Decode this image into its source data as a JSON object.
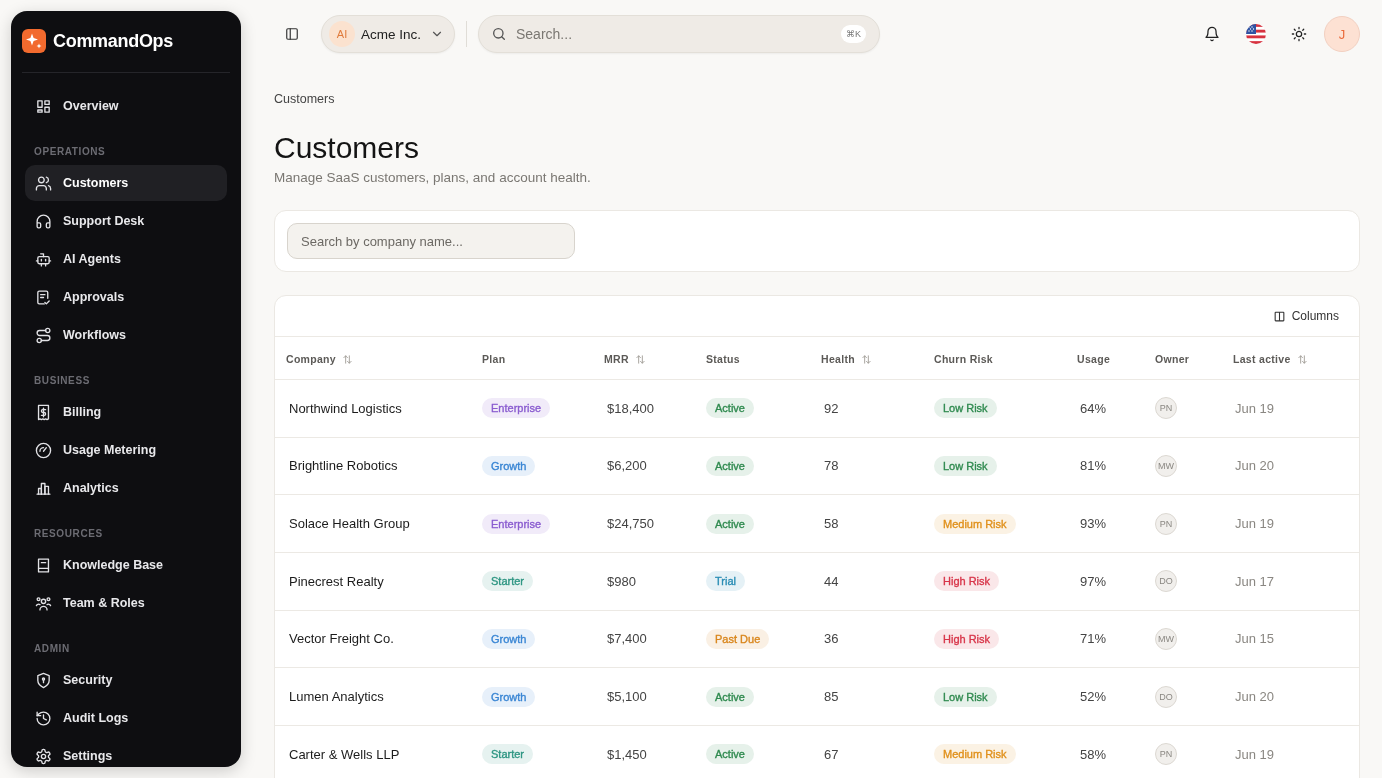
{
  "sidebar": {
    "brand": "CommandOps",
    "sections": [
      {
        "items": [
          {
            "label": "Overview",
            "selected": false
          }
        ]
      },
      {
        "title": "OPERATIONS",
        "items": [
          {
            "label": "Customers",
            "selected": true
          },
          {
            "label": "Support Desk",
            "selected": false
          },
          {
            "label": "AI Agents",
            "selected": false
          },
          {
            "label": "Approvals",
            "selected": false
          },
          {
            "label": "Workflows",
            "selected": false
          }
        ]
      },
      {
        "title": "BUSINESS",
        "items": [
          {
            "label": "Billing",
            "selected": false
          },
          {
            "label": "Usage Metering",
            "selected": false
          },
          {
            "label": "Analytics",
            "selected": false
          }
        ]
      },
      {
        "title": "RESOURCES",
        "items": [
          {
            "label": "Knowledge Base",
            "selected": false
          },
          {
            "label": "Team & Roles",
            "selected": false
          }
        ]
      },
      {
        "title": "ADMIN",
        "items": [
          {
            "label": "Security",
            "selected": false
          },
          {
            "label": "Audit Logs",
            "selected": false
          },
          {
            "label": "Settings",
            "selected": false
          }
        ]
      }
    ]
  },
  "topbar": {
    "org": {
      "initials": "AI",
      "name": "Acme Inc."
    },
    "search": {
      "placeholder": "Search...",
      "shortcut": "⌘K"
    },
    "user": {
      "initials": "J"
    }
  },
  "page_header": {
    "breadcrumb": "Customers",
    "title": "Customers",
    "subtitle": "Manage SaaS customers, plans, and account health."
  },
  "filter": {
    "placeholder": "Search by company name..."
  },
  "table": {
    "columns_button": "Columns",
    "columns": [
      {
        "label": "Company",
        "sortable": true
      },
      {
        "label": "Plan",
        "sortable": false
      },
      {
        "label": "MRR",
        "sortable": true
      },
      {
        "label": "Status",
        "sortable": false
      },
      {
        "label": "Health",
        "sortable": true
      },
      {
        "label": "Churn Risk",
        "sortable": false
      },
      {
        "label": "Usage",
        "sortable": false
      },
      {
        "label": "Owner",
        "sortable": false
      },
      {
        "label": "Last active",
        "sortable": true
      }
    ],
    "rows": [
      {
        "company": "Northwind Logistics",
        "plan": {
          "label": "Enterprise",
          "color": "#8a5cd0"
        },
        "mrr": "$18,400",
        "status": {
          "label": "Active",
          "color": "#2f8a4f"
        },
        "health": "92",
        "churn_risk": {
          "label": "Low Risk",
          "color": "#2f8a4f"
        },
        "usage": "64%",
        "owner": "PN",
        "last_active": "Jun 19"
      },
      {
        "company": "Brightline Robotics",
        "plan": {
          "label": "Growth",
          "color": "#3a86d4"
        },
        "mrr": "$6,200",
        "status": {
          "label": "Active",
          "color": "#2f8a4f"
        },
        "health": "78",
        "churn_risk": {
          "label": "Low Risk",
          "color": "#2f8a4f"
        },
        "usage": "81%",
        "owner": "MW",
        "last_active": "Jun 20"
      },
      {
        "company": "Solace Health Group",
        "plan": {
          "label": "Enterprise",
          "color": "#8a5cd0"
        },
        "mrr": "$24,750",
        "status": {
          "label": "Active",
          "color": "#2f8a4f"
        },
        "health": "58",
        "churn_risk": {
          "label": "Medium Risk",
          "color": "#e0901a"
        },
        "usage": "93%",
        "owner": "PN",
        "last_active": "Jun 19"
      },
      {
        "company": "Pinecrest Realty",
        "plan": {
          "label": "Starter",
          "color": "#2e9683"
        },
        "mrr": "$980",
        "status": {
          "label": "Trial",
          "color": "#2a8db5"
        },
        "health": "44",
        "churn_risk": {
          "label": "High Risk",
          "color": "#d8364a"
        },
        "usage": "97%",
        "owner": "DO",
        "last_active": "Jun 17"
      },
      {
        "company": "Vector Freight Co.",
        "plan": {
          "label": "Growth",
          "color": "#3a86d4"
        },
        "mrr": "$7,400",
        "status": {
          "label": "Past Due",
          "color": "#d9861c"
        },
        "health": "36",
        "churn_risk": {
          "label": "High Risk",
          "color": "#d8364a"
        },
        "usage": "71%",
        "owner": "MW",
        "last_active": "Jun 15"
      },
      {
        "company": "Lumen Analytics",
        "plan": {
          "label": "Growth",
          "color": "#3a86d4"
        },
        "mrr": "$5,100",
        "status": {
          "label": "Active",
          "color": "#2f8a4f"
        },
        "health": "85",
        "churn_risk": {
          "label": "Low Risk",
          "color": "#2f8a4f"
        },
        "usage": "52%",
        "owner": "DO",
        "last_active": "Jun 20"
      },
      {
        "company": "Carter & Wells LLP",
        "plan": {
          "label": "Starter",
          "color": "#2e9683"
        },
        "mrr": "$1,450",
        "status": {
          "label": "Active",
          "color": "#2f8a4f"
        },
        "health": "67",
        "churn_risk": {
          "label": "Medium Risk",
          "color": "#e0901a"
        },
        "usage": "58%",
        "owner": "PN",
        "last_active": "Jun 19"
      }
    ]
  }
}
